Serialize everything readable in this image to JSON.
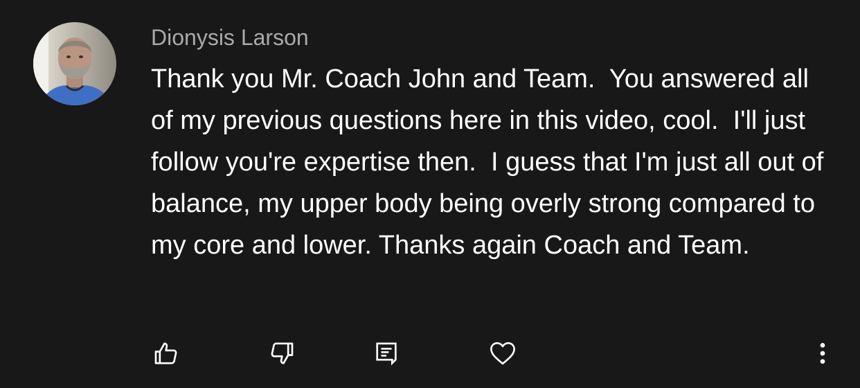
{
  "comment": {
    "author": "Dionysis Larson",
    "text": "Thank you Mr. Coach John and Team.  You answered all of my previous questions here in this video, cool.  I'll just follow you're expertise then.  I guess that I'm just all out of balance, my upper body being overly strong compared to my core and lower. Thanks again Coach and Team.",
    "avatar_icon": "profile-photo"
  },
  "actions": {
    "like_icon": "thumbs-up-icon",
    "dislike_icon": "thumbs-down-icon",
    "reply_icon": "reply-comment-icon",
    "heart_icon": "heart-icon",
    "more_icon": "more-vertical-icon"
  },
  "colors": {
    "background": "#181818",
    "author": "#aaaaaa",
    "text": "#ffffff",
    "icon": "#ffffff"
  }
}
